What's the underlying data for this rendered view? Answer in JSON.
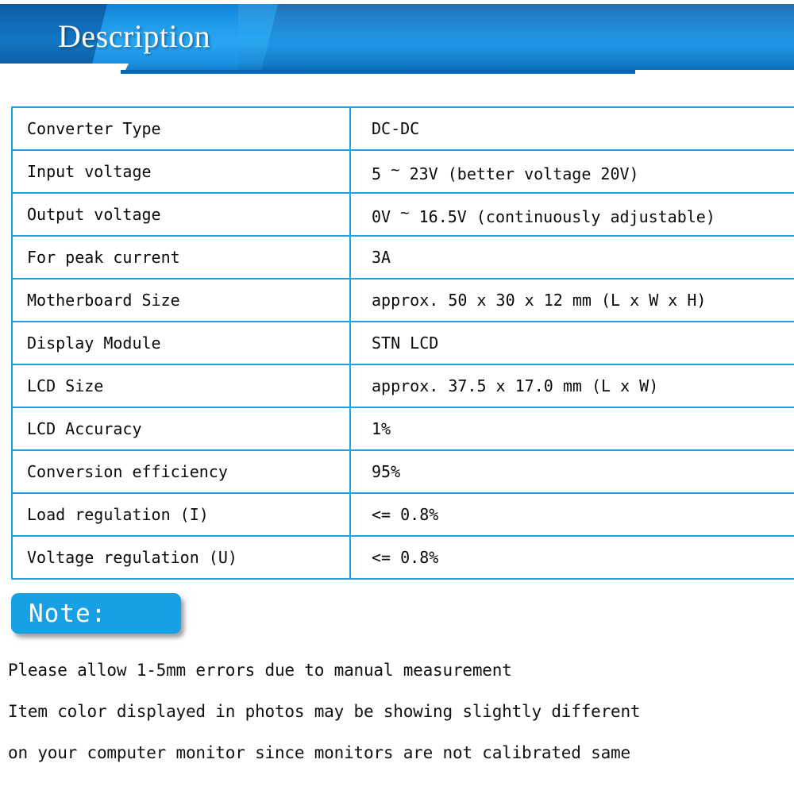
{
  "header": {
    "title": "Description",
    "banner_color_dark": "#0d5ba3",
    "banner_color_mid": "#1b8ddd",
    "banner_color_bright": "#29a6f3"
  },
  "spec_table": {
    "border_color": "#1a9fe0",
    "rows": [
      {
        "key": "Converter Type",
        "value_pre": "DC-DC",
        "value_tilde": "",
        "value_post": ""
      },
      {
        "key": "Input voltage",
        "value_pre": "5 ",
        "value_tilde": "~",
        "value_post": " 23V (better voltage 20V)"
      },
      {
        "key": "Output voltage",
        "value_pre": "0V ",
        "value_tilde": "~",
        "value_post": " 16.5V (continuously adjustable)"
      },
      {
        "key": "For peak current",
        "value_pre": "3A",
        "value_tilde": "",
        "value_post": ""
      },
      {
        "key": "Motherboard Size",
        "value_pre": "approx. 50 x 30 x 12 mm (L x W x H)",
        "value_tilde": "",
        "value_post": ""
      },
      {
        "key": "Display Module",
        "value_pre": "STN LCD",
        "value_tilde": "",
        "value_post": ""
      },
      {
        "key": "LCD Size",
        "value_pre": "approx. 37.5 x 17.0 mm (L x W)",
        "value_tilde": "",
        "value_post": ""
      },
      {
        "key": "LCD Accuracy",
        "value_pre": "1%",
        "value_tilde": "",
        "value_post": ""
      },
      {
        "key": "Conversion efficiency",
        "value_pre": "95%",
        "value_tilde": "",
        "value_post": ""
      },
      {
        "key": "Load regulation (I)",
        "value_pre": "<= 0.8%",
        "value_tilde": "",
        "value_post": ""
      },
      {
        "key": "Voltage regulation (U)",
        "value_pre": "<= 0.8%",
        "value_tilde": "",
        "value_post": ""
      }
    ]
  },
  "note": {
    "badge_label": "Note:",
    "badge_color": "#18a0e4",
    "lines": [
      "Please allow 1-5mm errors due to manual measurement",
      "Item color displayed in photos may be showing slightly different",
      "on your computer monitor since monitors are not calibrated same"
    ]
  }
}
